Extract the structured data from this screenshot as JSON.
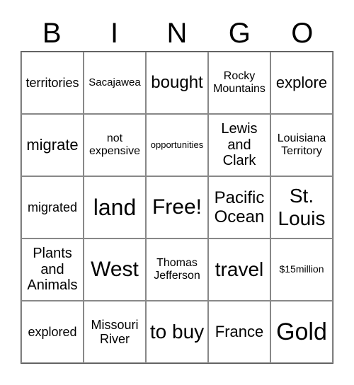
{
  "header": {
    "letters": [
      "B",
      "I",
      "N",
      "G",
      "O"
    ]
  },
  "grid": {
    "rows": [
      [
        "territories",
        "Sacajawea",
        "bought",
        "Rocky Mountains",
        "explore"
      ],
      [
        "migrate",
        "not expensive",
        "opportunities",
        "Lewis and Clark",
        "Louisiana Territory"
      ],
      [
        "migrated",
        "land",
        "Free!",
        "Pacific Ocean",
        "St. Louis"
      ],
      [
        "Plants and Animals",
        "West",
        "Thomas Jefferson",
        "travel",
        "$15million"
      ],
      [
        "explored",
        "Missouri River",
        "to buy",
        "France",
        "Gold"
      ]
    ]
  }
}
